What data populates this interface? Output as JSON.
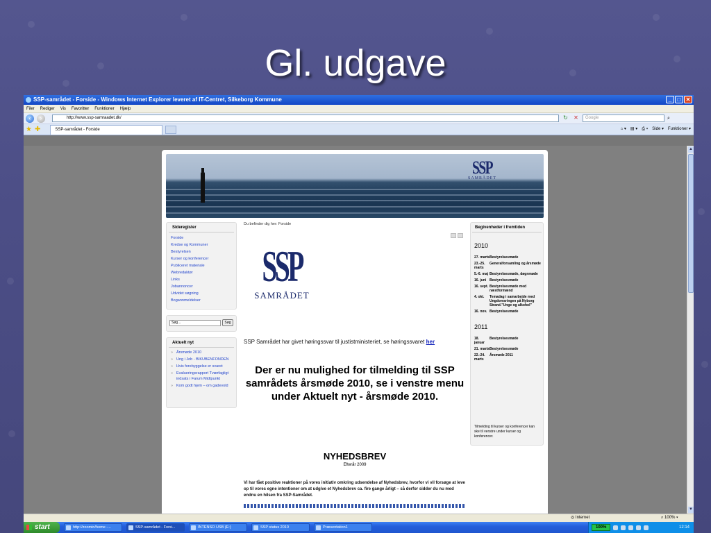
{
  "slide": {
    "title": "Gl. udgave"
  },
  "browser": {
    "window_title": "SSP-samrådet - Forside - Windows Internet Explorer leveret af IT-Centret, Silkeborg Kommune",
    "menu": [
      "Filer",
      "Rediger",
      "Vis",
      "Favoritter",
      "Funktioner",
      "Hjælp"
    ],
    "address": "http://www.ssp-samraadet.dk/",
    "search_placeholder": "Google",
    "tab_label": "SSP-samrådet - Forside",
    "tools": [
      "Side ▾",
      "Funktioner ▾"
    ],
    "status_zone": "Internet",
    "status_zoom": "100%"
  },
  "site": {
    "banner_logo": {
      "mark": "SSP",
      "name": "SAMRÅDET"
    },
    "sideregister": {
      "heading": "Sideregister",
      "items": [
        "Forside",
        "Kredse og Kommuner",
        "Bestyrelsen",
        "Kurser og konferencer",
        "Publiceret materiale",
        "Webredaktør",
        "Links",
        "Jobannoncer",
        "Udvidet søgning",
        "Bogannmeldelser"
      ]
    },
    "search": {
      "value": "Søg...",
      "button": "Søg"
    },
    "aktuelt": {
      "heading": "Aktuelt nyt",
      "items": [
        "Årsmøde 2010",
        "Ung i Job - BIKUBENFONDEN",
        "Hvis forebyggelse er svaret",
        "Evalueringsrapport Tværfagligt indsats i Farum Midtpunkt",
        "Kom godt hjem – om gadevold"
      ]
    },
    "breadcrumb": "Du befinder dig her: Forside",
    "logo": {
      "mark": "SSP",
      "name": "SAMRÅDET"
    },
    "govt_text": "SSP Samrådet har givet høringssvar til justistministeriet, se høringssvaret",
    "govt_link": "her",
    "headline": "Der er nu mulighed for tilmelding til SSP samrådets årsmøde 2010, se i venstre menu under Aktuelt nyt - årsmøde 2010.",
    "newsletter": {
      "title": "NYHEDSBREV",
      "subtitle": "Efterår 2009",
      "body": "Vi har fået positive reaktioner på vores initiativ omkring udsendelse af Nyhedsbrev, hvorfor vi vil forsøge at leve op til vores egne intentioner om at udgive et Nyhedsbrev ca. fire gange årligt – så derfor sidder du nu med endnu en hilsen fra SSP-Samrådet."
    },
    "events": {
      "heading": "Begivenheder i fremtiden",
      "years": [
        {
          "year": "2010",
          "items": [
            {
              "date": "27. marts",
              "title": "Bestyrelsesmøde"
            },
            {
              "date": "23.-25. marts",
              "title": "Generalforsamling og årsmøde"
            },
            {
              "date": "5.-6. maj",
              "title": "Bestyrelsesmøde, døgnmøde"
            },
            {
              "date": "16. juni",
              "title": "Bestyrelsesmøde"
            },
            {
              "date": "16. sept.",
              "title": "Bestyrelsesmøde med næstformænd"
            },
            {
              "date": "4. okt.",
              "title": "Temadag i samarbejde med Ungdomsringen på Nyborg Strand.\"Unge og alkohol\""
            },
            {
              "date": "16. nov.",
              "title": "Bestyrelsesmøde"
            }
          ]
        },
        {
          "year": "2011",
          "items": [
            {
              "date": "18. januar",
              "title": "Bestyrelsesmøde"
            },
            {
              "date": "21. marts",
              "title": "Bestyrelsesmøde"
            },
            {
              "date": "22.-24. marts",
              "title": "Årsmøde 2011"
            }
          ]
        }
      ],
      "note": "Tilmelding til kurser og konferencer kan ske til venstre under kurser og konferencer."
    }
  },
  "taskbar": {
    "start": "start",
    "items": [
      "http://zoomin/home -...",
      "SSP-samrådet - Forsi...",
      "INTENSO USB (E:)",
      "SSP status 2010",
      "Præsentation1"
    ],
    "battery": "100%",
    "clock": "12:14"
  }
}
